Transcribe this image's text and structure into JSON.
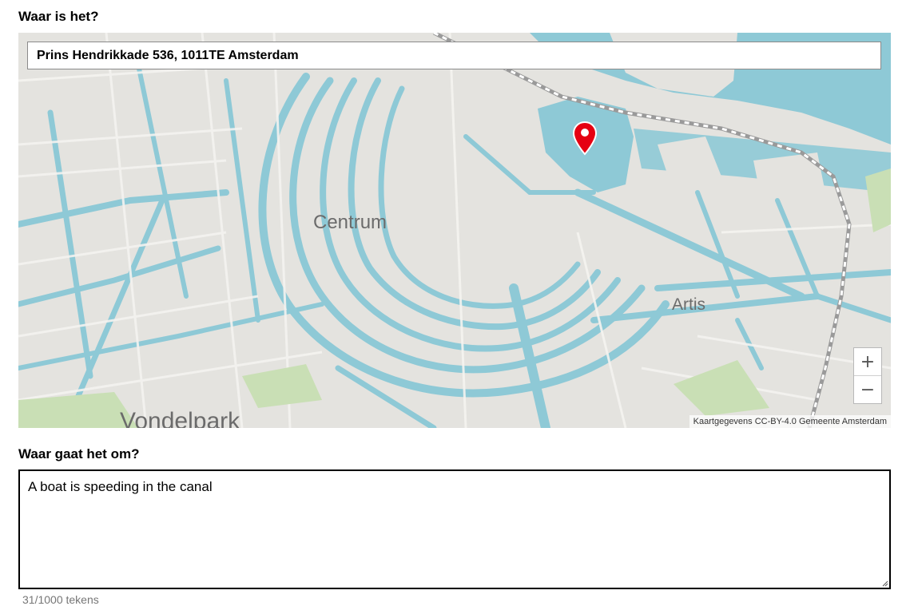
{
  "form": {
    "location_label": "Waar is het?",
    "description_label": "Waar gaat het om?"
  },
  "map": {
    "address_value": "Prins Hendrikkade 536, 1011TE Amsterdam",
    "place_labels": {
      "centrum": "Centrum",
      "artis": "Artis",
      "vondelpark": "Vondelpark"
    },
    "zoom_in": "+",
    "zoom_out": "−",
    "attribution": "Kaartgegevens CC-BY-4.0 Gemeente Amsterdam",
    "marker_icon": "map-pin-icon",
    "marker_color": "#e50012",
    "water_color": "#8ec9d6",
    "land_color": "#e4e3df"
  },
  "description": {
    "value": "A boat is speeding in the canal",
    "counter": "31/1000 tekens"
  }
}
